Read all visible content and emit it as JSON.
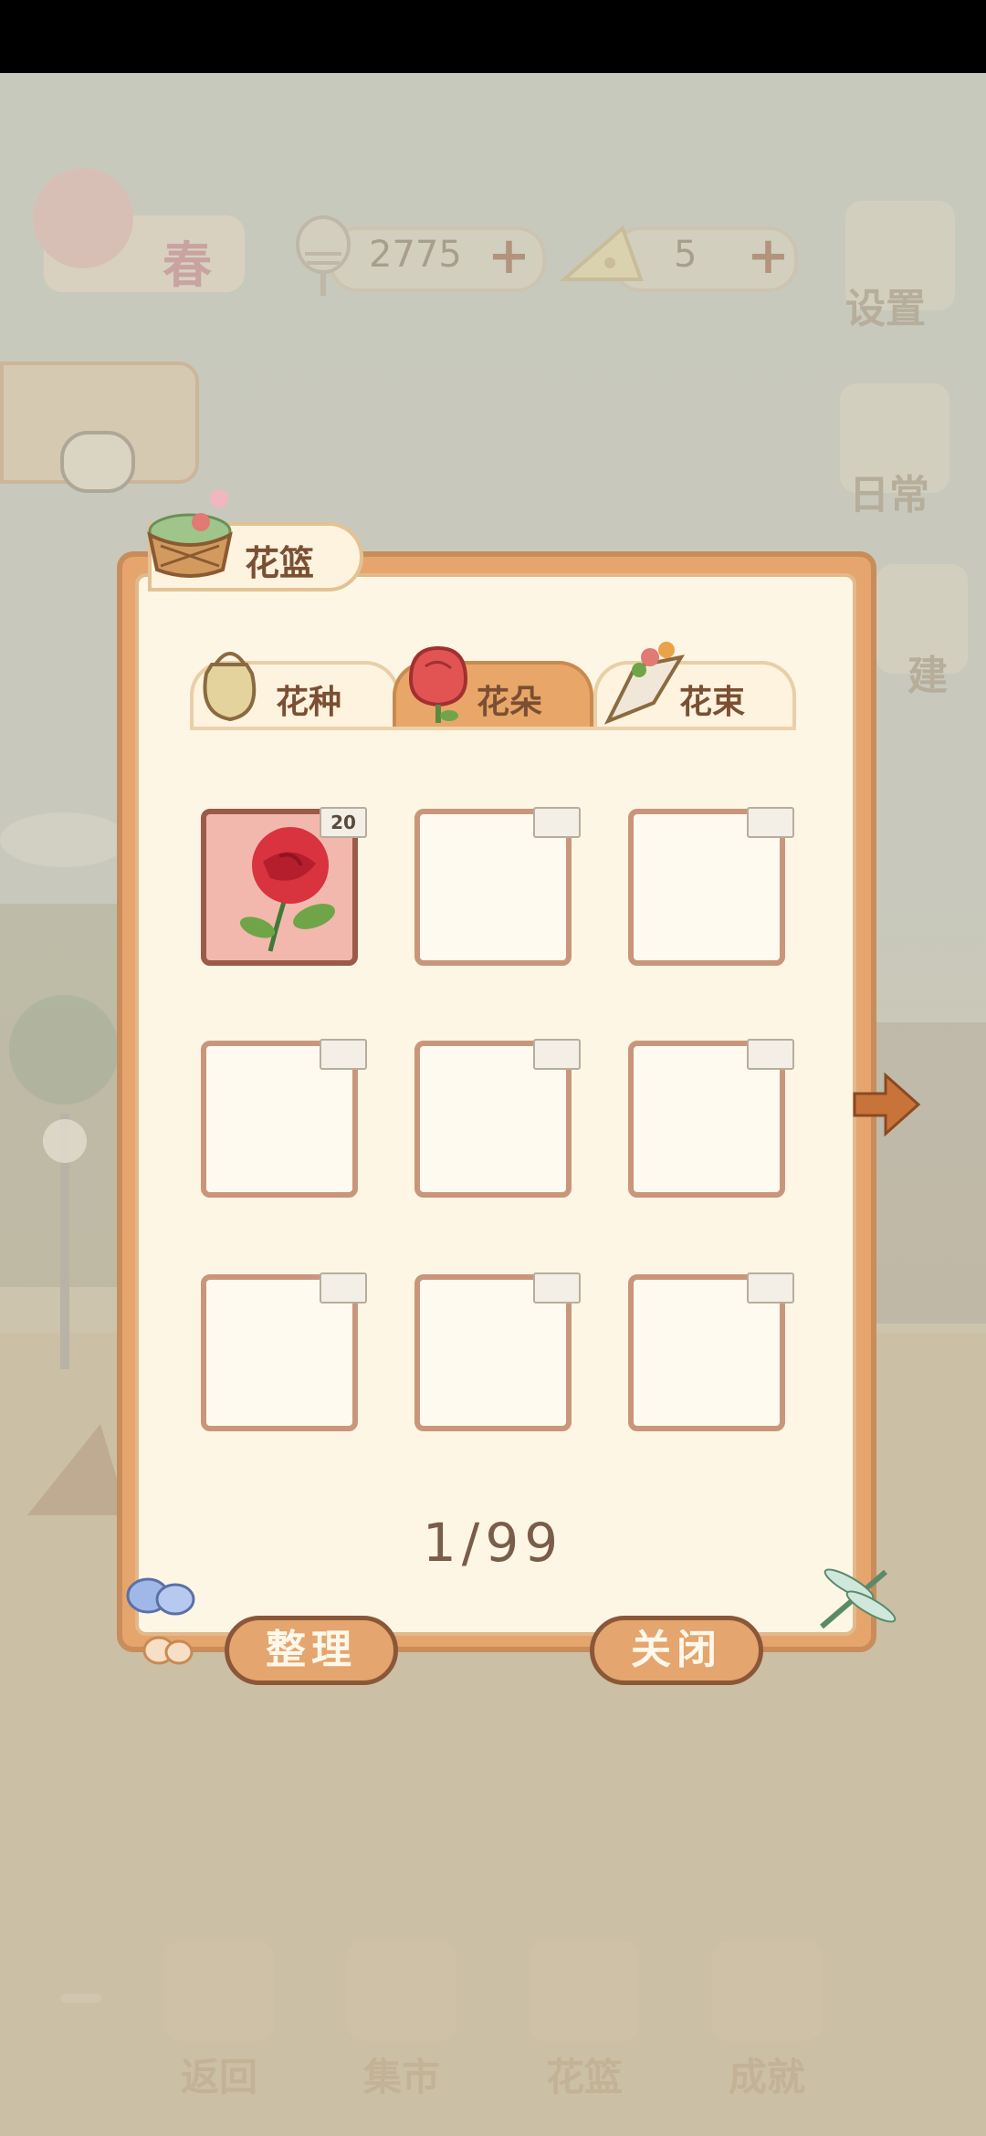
{
  "hud": {
    "season_label": "春",
    "fish_value": "2775",
    "cheese_value": "5",
    "plus_symbol": "+",
    "settings_label": "设置",
    "daily_label": "日常",
    "build_label": "建"
  },
  "panel": {
    "title": "花篮",
    "tabs": [
      {
        "label": "花种",
        "active": false
      },
      {
        "label": "花朵",
        "active": true
      },
      {
        "label": "花束",
        "active": false
      }
    ],
    "slots": [
      {
        "item": "rose",
        "count": "20"
      },
      {
        "item": "",
        "count": ""
      },
      {
        "item": "",
        "count": ""
      },
      {
        "item": "",
        "count": ""
      },
      {
        "item": "",
        "count": ""
      },
      {
        "item": "",
        "count": ""
      },
      {
        "item": "",
        "count": ""
      },
      {
        "item": "",
        "count": ""
      },
      {
        "item": "",
        "count": ""
      }
    ],
    "page_indicator": "1/99",
    "sort_button": "整理",
    "close_button": "关闭"
  },
  "bottom_nav": [
    {
      "label": "返回",
      "icon": "window-icon"
    },
    {
      "label": "集市",
      "icon": "market-icon"
    },
    {
      "label": "花篮",
      "icon": "basket-icon"
    },
    {
      "label": "成就",
      "icon": "trophy-icon"
    }
  ],
  "colors": {
    "panel_orange": "#e6a56d",
    "panel_cream": "#fdf6e4",
    "text_brown": "#7a4f33"
  }
}
